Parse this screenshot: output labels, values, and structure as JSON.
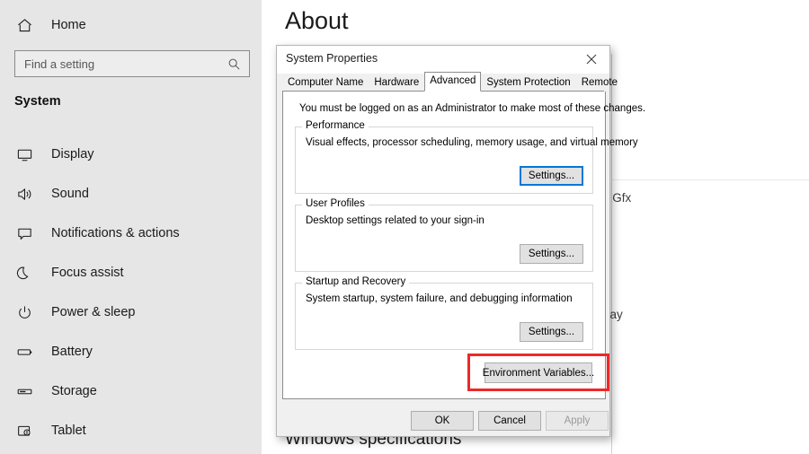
{
  "sidebar": {
    "home_label": "Home",
    "home_icon": "home-icon",
    "search": {
      "placeholder": "Find a setting",
      "icon": "search-icon"
    },
    "section_header": "System",
    "items": [
      {
        "label": "Display",
        "icon": "monitor-icon"
      },
      {
        "label": "Sound",
        "icon": "speaker-icon"
      },
      {
        "label": "Notifications & actions",
        "icon": "comment-icon"
      },
      {
        "label": "Focus assist",
        "icon": "moon-icon"
      },
      {
        "label": "Power & sleep",
        "icon": "power-icon"
      },
      {
        "label": "Battery",
        "icon": "battery-icon"
      },
      {
        "label": "Storage",
        "icon": "drive-icon"
      },
      {
        "label": "Tablet",
        "icon": "tablet-icon"
      }
    ]
  },
  "page": {
    "title": "About",
    "section_heading": "Windows specifications",
    "background_fragments": {
      "gfx": "e Gfx",
      "play": "play"
    }
  },
  "dialog": {
    "title": "System Properties",
    "close_icon": "close-icon",
    "tabs": [
      {
        "label": "Computer Name",
        "selected": false
      },
      {
        "label": "Hardware",
        "selected": false
      },
      {
        "label": "Advanced",
        "selected": true
      },
      {
        "label": "System Protection",
        "selected": false
      },
      {
        "label": "Remote",
        "selected": false
      }
    ],
    "admin_note": "You must be logged on as an Administrator to make most of these changes.",
    "groups": [
      {
        "legend": "Performance",
        "description": "Visual effects, processor scheduling, memory usage, and virtual memory",
        "button_label": "Settings...",
        "focused": true
      },
      {
        "legend": "User Profiles",
        "description": "Desktop settings related to your sign-in",
        "button_label": "Settings...",
        "focused": false
      },
      {
        "legend": "Startup and Recovery",
        "description": "System startup, system failure, and debugging information",
        "button_label": "Settings...",
        "focused": false
      }
    ],
    "environment_variables_label": "Environment Variables...",
    "footer": {
      "ok_label": "OK",
      "cancel_label": "Cancel",
      "apply_label": "Apply"
    }
  },
  "annotation": {
    "highlight_color": "#ef2828",
    "target": "environment-variables-button"
  }
}
